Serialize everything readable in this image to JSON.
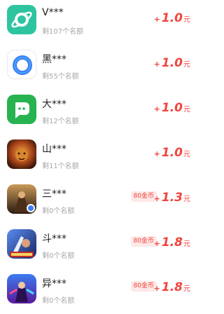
{
  "items": [
    {
      "name": "V***",
      "quota": "剩107个名额",
      "plus": "+",
      "amount": "1.0",
      "unit": "元",
      "coin": "",
      "icon": "planet-app-icon",
      "color": "#2ec4a0"
    },
    {
      "name": "黑***",
      "quota": "剩55个名额",
      "plus": "+",
      "amount": "1.0",
      "unit": "元",
      "coin": "",
      "icon": "ring-app-icon",
      "color": "#3d7cf5"
    },
    {
      "name": "大***",
      "quota": "剩12个名额",
      "plus": "+",
      "amount": "1.0",
      "unit": "元",
      "coin": "",
      "icon": "chat-app-icon",
      "color": "#27b350"
    },
    {
      "name": "山***",
      "quota": "剩11个名额",
      "plus": "+",
      "amount": "1.0",
      "unit": "元",
      "coin": "",
      "icon": "lion-game-icon",
      "color": "#b5501f"
    },
    {
      "name": "三***",
      "quota": "剩0个名额",
      "plus": "+",
      "amount": "1.3",
      "unit": "元",
      "coin": "80金币",
      "icon": "warrior-game-icon",
      "color": "#6b4a2a"
    },
    {
      "name": "斗***",
      "quota": "剩0个名额",
      "plus": "+",
      "amount": "1.8",
      "unit": "元",
      "coin": "80金币",
      "icon": "battle-game-icon",
      "color": "#2a3f8c"
    },
    {
      "name": "异***",
      "quota": "剩0个名额",
      "plus": "+",
      "amount": "1.8",
      "unit": "元",
      "coin": "80金币",
      "icon": "hero-game-icon",
      "color": "#4a2a9c"
    }
  ]
}
